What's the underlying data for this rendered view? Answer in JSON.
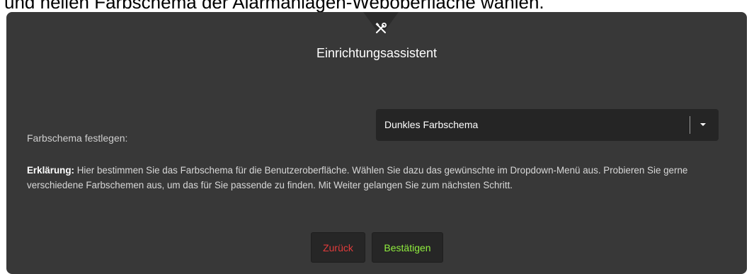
{
  "caption": "und hellen Farbschema der Alarmanlagen-Weboberfläche wählen.",
  "dialog": {
    "tab_icon": "tools-icon",
    "title": "Einrichtungsassistent"
  },
  "color_scheme": {
    "label": "Farbschema festlegen:",
    "selected": "Dunkles Farbschema",
    "caret_icon": "caret-down-icon"
  },
  "explanation": {
    "heading": "Erklärung:",
    "text": "Hier bestimmen Sie das Farbschema für die Benutzeroberfläche. Wählen Sie dazu das gewünschte im Dropdown-Menü aus. Probieren Sie gerne verschiedene Farbschemen aus, um das für Sie passende zu finden. Mit Weiter gelangen Sie zum nächsten Schritt."
  },
  "buttons": {
    "back_label": "Zurück",
    "confirm_label": "Bestätigen"
  },
  "colors": {
    "panel_bg": "#383838",
    "input_bg": "#252525",
    "back_text": "#e23b3b",
    "confirm_text": "#90ee3e"
  }
}
